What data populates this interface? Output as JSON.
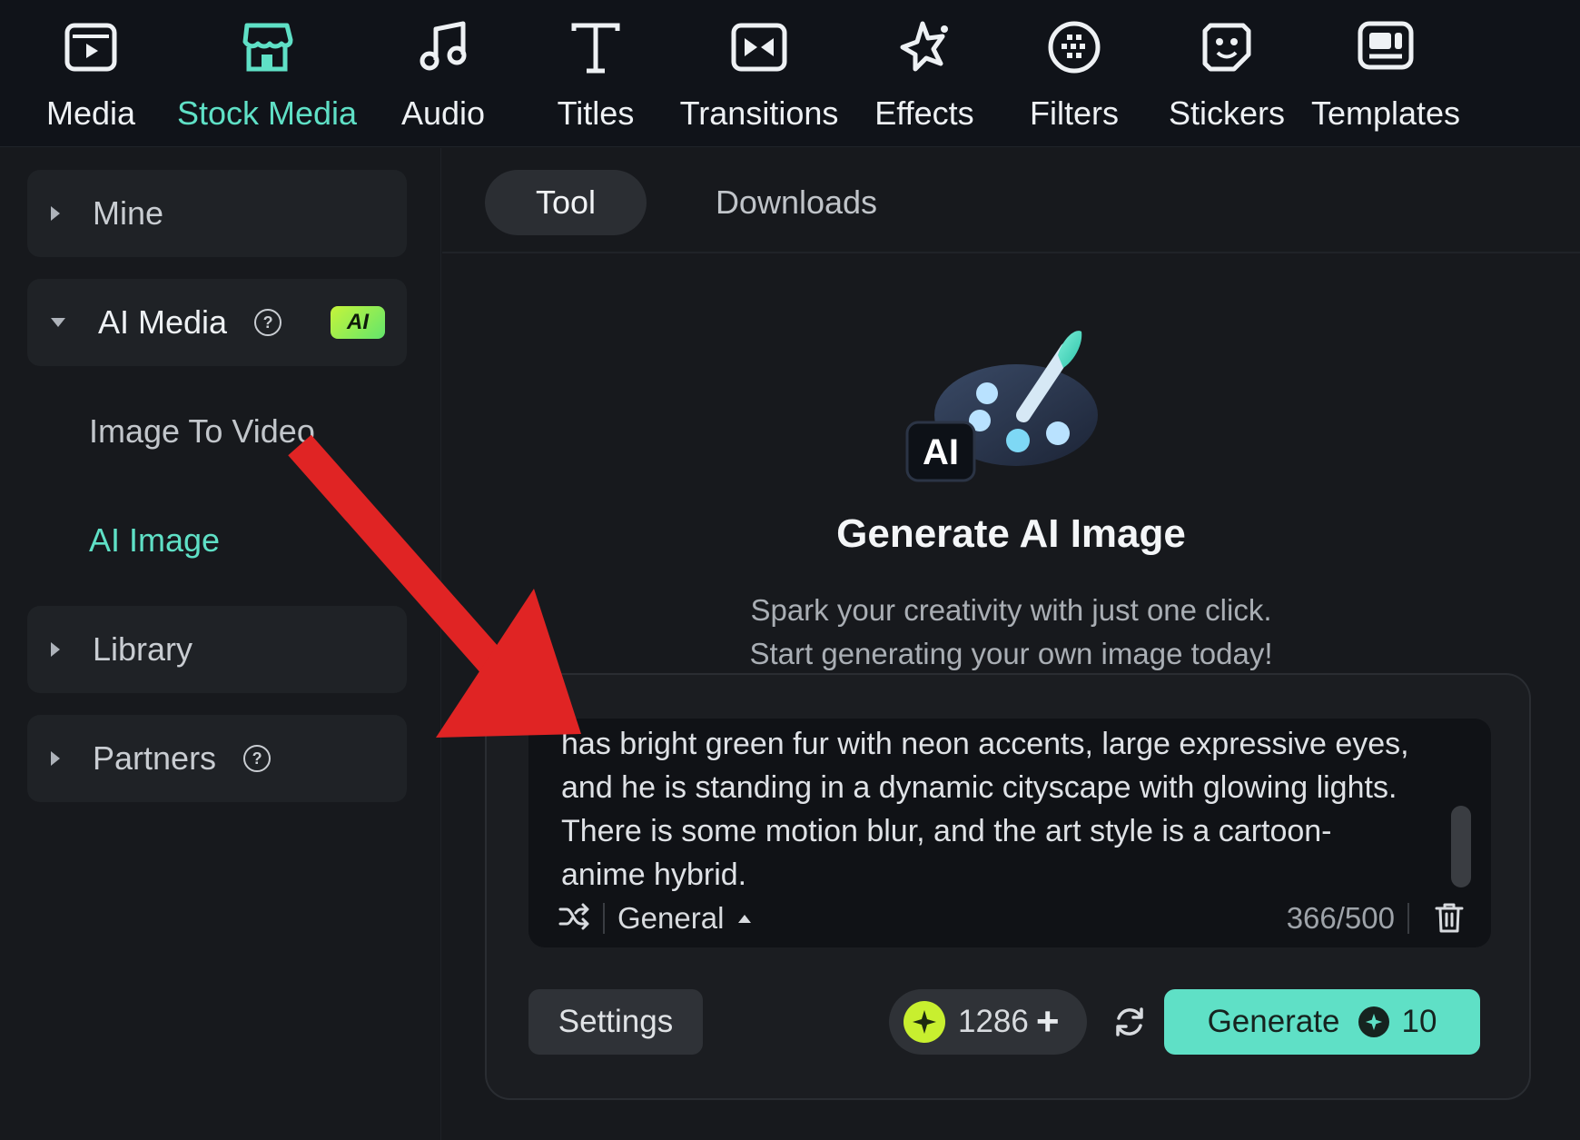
{
  "toolbar": {
    "items": [
      {
        "label": "Media",
        "icon": "media-icon"
      },
      {
        "label": "Stock Media",
        "icon": "stock-media-icon",
        "active": true
      },
      {
        "label": "Audio",
        "icon": "music-note-icon"
      },
      {
        "label": "Titles",
        "icon": "text-t-icon"
      },
      {
        "label": "Transitions",
        "icon": "transition-icon"
      },
      {
        "label": "Effects",
        "icon": "sparkle-star-icon"
      },
      {
        "label": "Filters",
        "icon": "filter-circle-icon"
      },
      {
        "label": "Stickers",
        "icon": "sticker-face-icon"
      },
      {
        "label": "Templates",
        "icon": "template-icon"
      }
    ]
  },
  "sidebar": {
    "groups": [
      {
        "label": "Mine"
      },
      {
        "label": "AI Media",
        "badge": "AI",
        "help": "?"
      },
      {
        "label": "Library"
      },
      {
        "label": "Partners",
        "help": "?"
      }
    ],
    "sub_items": [
      {
        "label": "Image To Video"
      },
      {
        "label": "AI Image",
        "active": true
      }
    ]
  },
  "tabs": [
    {
      "label": "Tool",
      "selected": true
    },
    {
      "label": "Downloads"
    }
  ],
  "hero": {
    "icon": "ai-palette-icon",
    "icon_badge": "AI",
    "title": "Generate AI Image",
    "subtitle_line1": "Spark your creativity with just one click.",
    "subtitle_line2": "Start generating your own image today!"
  },
  "prompt": {
    "text": "has bright green fur with neon accents, large expressive eyes, and he is standing in a dynamic cityscape with glowing lights. There is some motion blur, and the art style is a cartoon-anime hybrid.",
    "style": "General",
    "counter": "366/500"
  },
  "actions": {
    "settings_label": "Settings",
    "credits": "1286",
    "plus": "+",
    "generate_label": "Generate",
    "generate_cost": "10"
  },
  "colors": {
    "accent": "#5fe0c6",
    "annotation_arrow": "#e02424",
    "ai_badge": "#b5f23a"
  }
}
